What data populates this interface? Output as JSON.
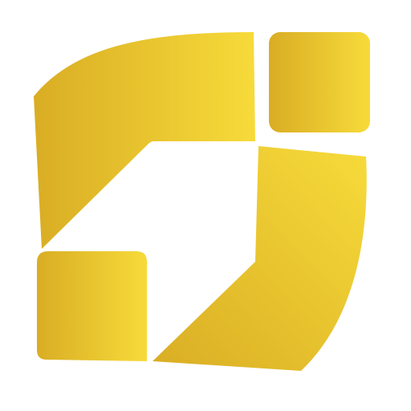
{
  "logo": {
    "name": "abstract-geometric-logo-mark",
    "colors": {
      "gold_light": "#F7DB3A",
      "gold_mid": "#EDC92F",
      "gold_dark": "#D9AD24",
      "background": "#FFFFFF"
    }
  }
}
